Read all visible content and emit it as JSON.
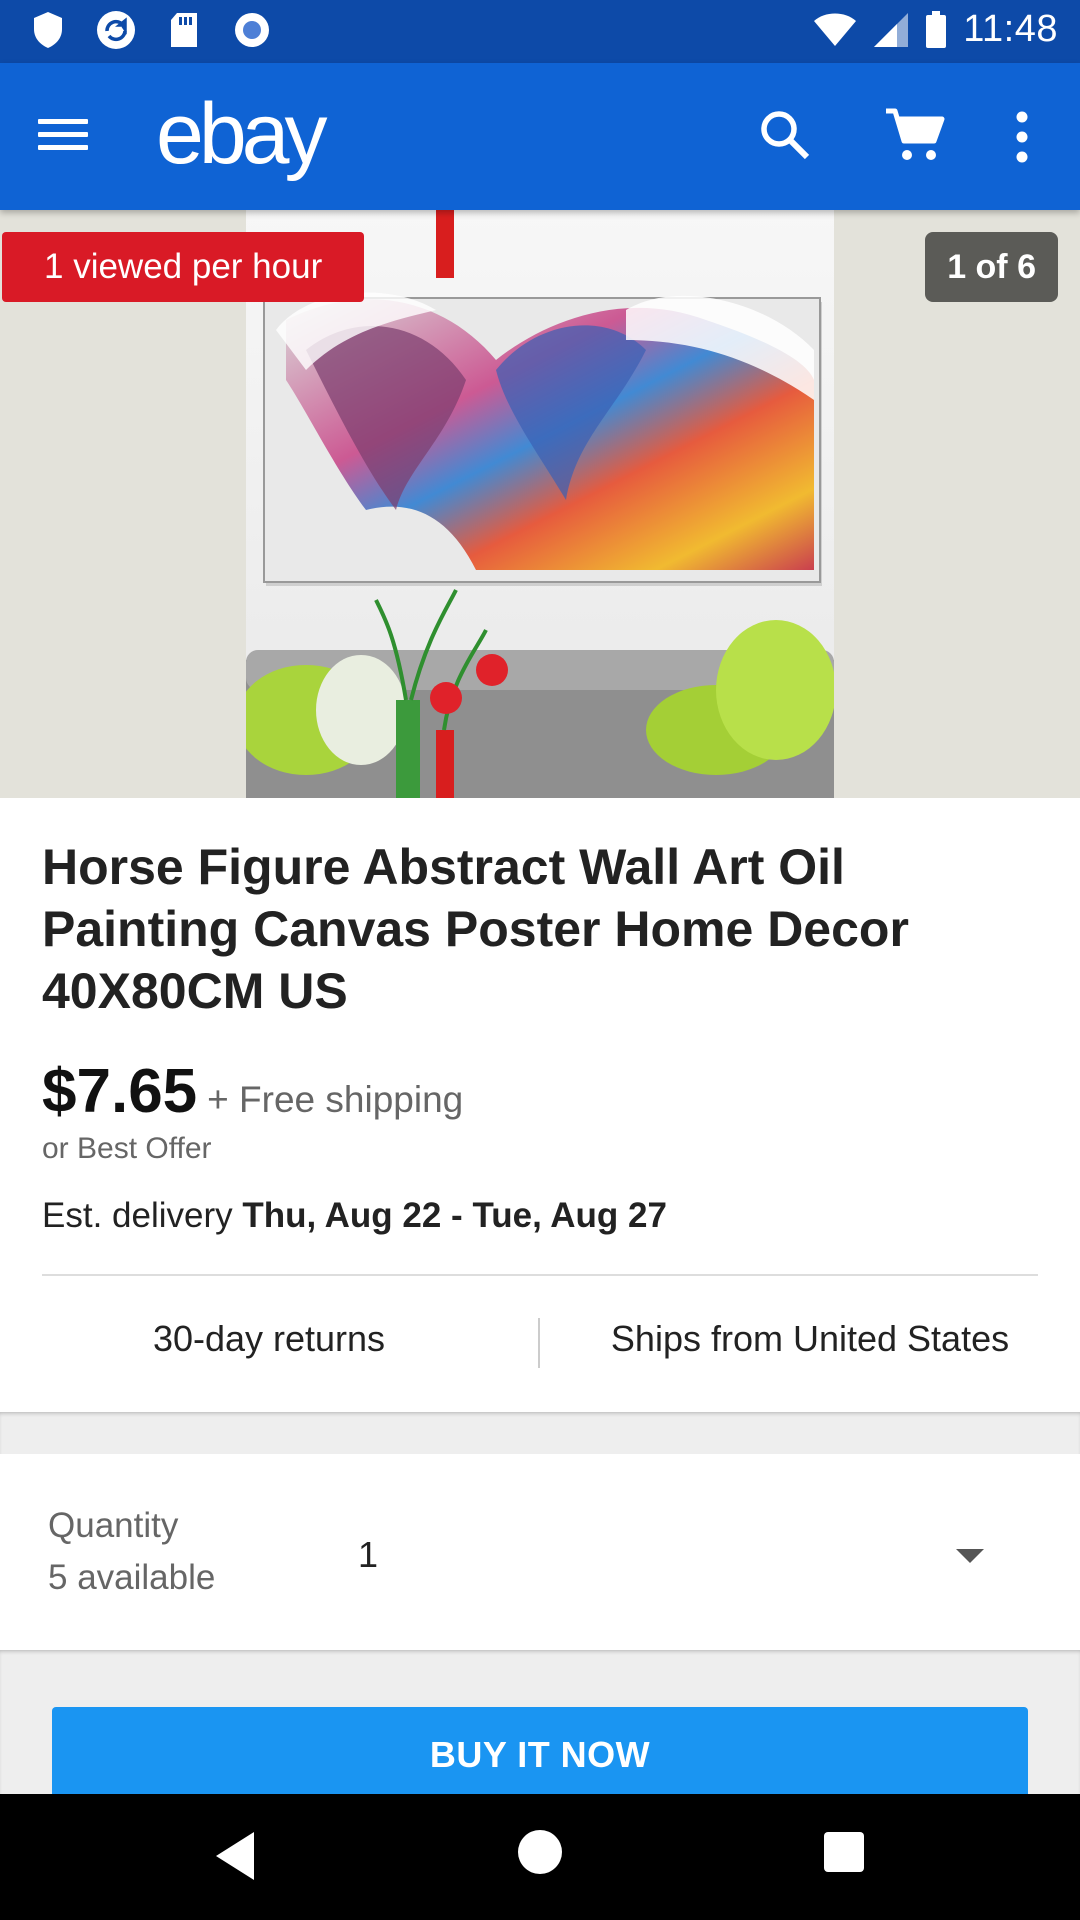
{
  "status_bar": {
    "time": "11:48",
    "icons": [
      "shield-icon",
      "sync-icon",
      "sd-card-icon",
      "record-icon",
      "wifi-icon",
      "signal-icon",
      "battery-icon"
    ]
  },
  "app_bar": {
    "logo": "ebay",
    "icons": [
      "menu-icon",
      "search-icon",
      "cart-icon",
      "more-vert-icon"
    ],
    "color": "#0f63d4"
  },
  "hero": {
    "viewed_badge": "1 viewed per hour",
    "image_counter": "1 of 6"
  },
  "listing": {
    "title": "Horse Figure Abstract Wall Art Oil Painting Canvas Poster Home Decor 40X80CM US",
    "price": "$7.65",
    "shipping": "+ Free shipping",
    "offer": "or Best Offer",
    "delivery_prefix": "Est. delivery",
    "delivery_dates": "Thu, Aug 22 - Tue, Aug 27",
    "returns": "30-day returns",
    "ships_from": "Ships from United States"
  },
  "quantity": {
    "label": "Quantity",
    "available": "5 available",
    "value": "1"
  },
  "actions": {
    "buy_now": "BUY IT NOW",
    "buy_color": "#1a95f2"
  },
  "nav_bar": {
    "icons": [
      "back-icon",
      "home-icon",
      "recents-icon"
    ]
  }
}
